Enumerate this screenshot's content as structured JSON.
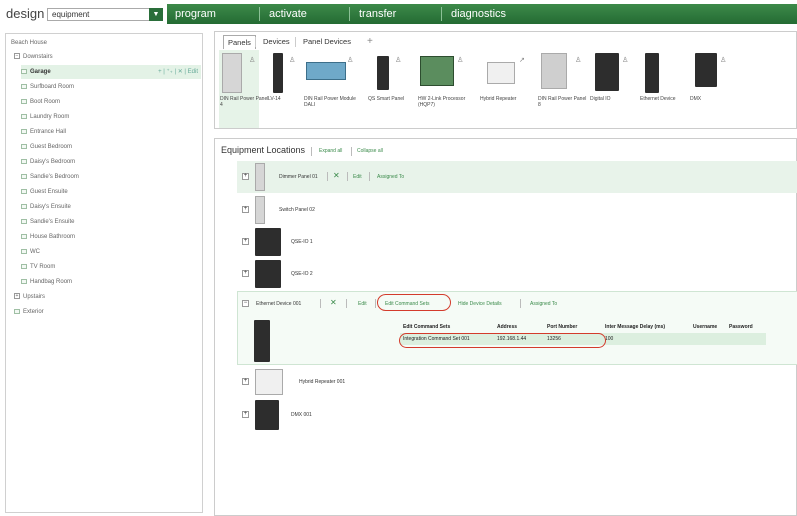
{
  "app": {
    "logo": "design",
    "mode_value": "equipment",
    "nav": [
      "program",
      "activate",
      "transfer",
      "diagnostics"
    ]
  },
  "tree": {
    "root": "Beach House",
    "downstairs": "Downstairs",
    "selected_tools": "+ | ⁺₊ | ✕ | Edit",
    "rooms": [
      "Garage",
      "Surfboard Room",
      "Boot Room",
      "Laundry Room",
      "Entrance Hall",
      "Guest Bedroom",
      "Daisy's Bedroom",
      "Sandie's Bedroom",
      "Guest Ensuite",
      "Daisy's Ensuite",
      "Sandie's Ensuite",
      "House Bathroom",
      "WC",
      "TV Room",
      "Handbag Room"
    ],
    "upstairs": "Upstairs",
    "exterior": "Exterior"
  },
  "panels": {
    "tabs": [
      "Panels",
      "Devices",
      "Panel Devices"
    ],
    "add_tab": "+",
    "devices": [
      "DIN Rail Power Panel 4",
      "LV-14",
      "DIN Rail Power Module DALI",
      "QS Smart Panel",
      "HW 2-Link Processor (HQP7)",
      "Hybrid Repeater",
      "DIN Rail Power Panel 8",
      "Digital IO",
      "Ethernet Device",
      "DMX"
    ]
  },
  "locations": {
    "title": "Equipment Locations",
    "expand_all": "Expand all",
    "collapse_all": "Collapse all",
    "rows": {
      "dimmer": {
        "name": "Dimmer Panel 01",
        "x": "✕",
        "edit": "Edit",
        "assigned": "Assigned To"
      },
      "switch": {
        "name": "Switch Panel 02"
      },
      "qse1": {
        "name": "QSE-IO 1"
      },
      "qse2": {
        "name": "QSE-IO 2"
      },
      "ethernet": {
        "name": "Ethernet Device 001",
        "x": "✕",
        "edit": "Edit",
        "edit_cmd": "Edit Command Sets",
        "hide": "Hide Device Details",
        "assigned": "Assigned To"
      },
      "hybrid": {
        "name": "Hybrid Repeater 001"
      },
      "dmx": {
        "name": "DMX 001"
      }
    },
    "cmd_table": {
      "headers": [
        "Edit Command Sets",
        "Address",
        "Port Number",
        "Inter Message Delay (ms)",
        "Username",
        "Password"
      ],
      "row": [
        "Integration Command Set 001",
        "192.168.1.44",
        "13256",
        "100",
        "",
        ""
      ]
    }
  },
  "colors": {
    "accent": "#2e7d3e",
    "highlight": "#d33b2c",
    "selection": "#e3f2e6"
  }
}
